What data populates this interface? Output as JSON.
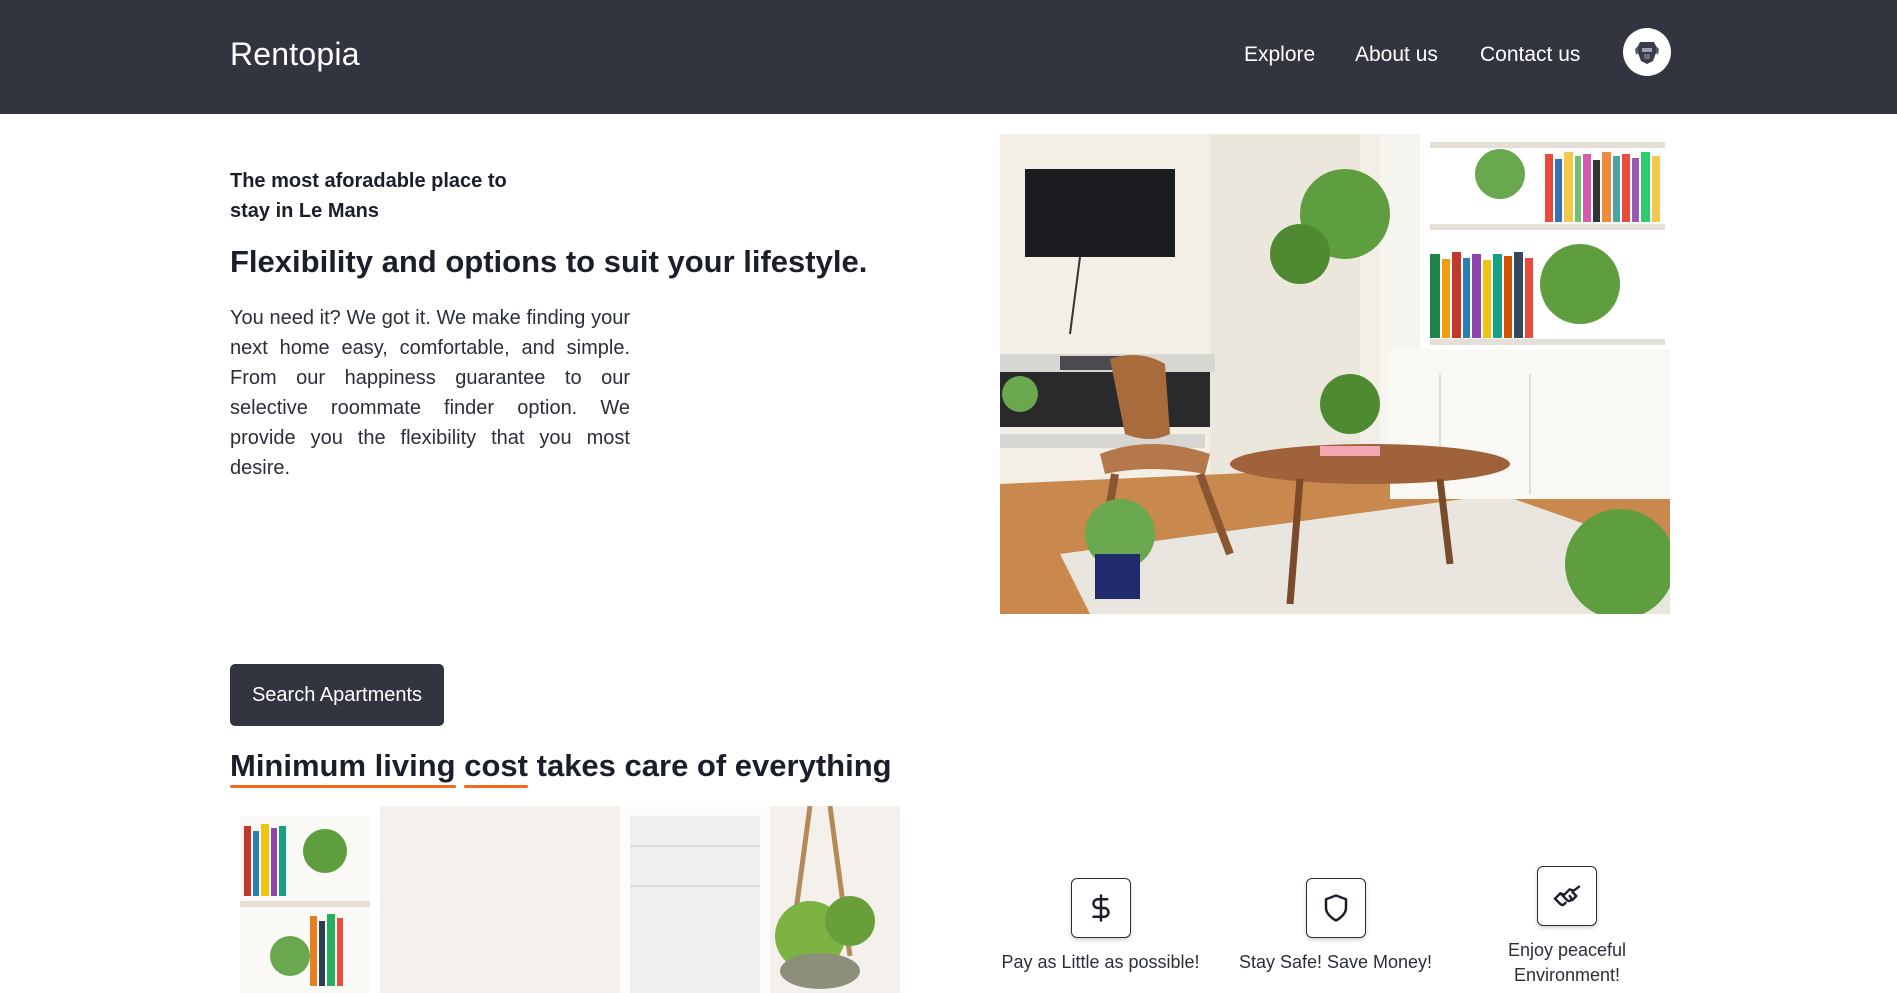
{
  "header": {
    "brand": "Rentopia",
    "nav": {
      "explore": "Explore",
      "about": "About us",
      "contact": "Contact us"
    },
    "avatar_icon": "robot-head-icon"
  },
  "hero": {
    "eyebrow": "The most aforadable place to stay in Le Mans",
    "title": "Flexibility and options to suit your lifestyle.",
    "body": "You need it? We got it. We make finding your next home easy, comfortable, and simple. From our happiness guarantee to our selective roommate finder option. We provide you the flexibility that you most desire.",
    "image_icon": "living-room-photo"
  },
  "cta": {
    "label": "Search Apartments"
  },
  "section": {
    "title_underlined_1": "Minimum living",
    "title_underlined_2": "cost",
    "title_rest": "takes care of everything",
    "accent_color": "#f06a1c",
    "image_icon": "bright-room-photo"
  },
  "features": [
    {
      "icon": "dollar-icon",
      "label": "Pay as Little as possible!"
    },
    {
      "icon": "shield-icon",
      "label": "Stay Safe! Save Money!"
    },
    {
      "icon": "handshake-icon",
      "label": "Enjoy peaceful Environment!"
    }
  ],
  "colors": {
    "navbar": "#323440",
    "button": "#323440",
    "accent": "#f06a1c"
  }
}
